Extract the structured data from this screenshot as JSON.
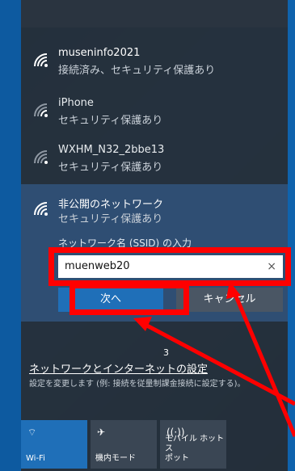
{
  "networks": [
    {
      "name": "museninfo2021",
      "status": "接続済み、セキュリティ保護あり"
    },
    {
      "name": "iPhone",
      "status": "セキュリティ保護あり"
    },
    {
      "name": "WXHM_N32_2bbe13",
      "status": "セキュリティ保護あり"
    },
    {
      "name": "非公開のネットワーク",
      "status": "セキュリティ保護あり"
    }
  ],
  "ssid_form": {
    "label": "ネットワーク名 (SSID) の入力",
    "value": "muenweb20",
    "clear_glyph": "×",
    "next_label": "次へ",
    "cancel_label": "キャンセル"
  },
  "annotation": {
    "step": "3"
  },
  "settings": {
    "link": "ネットワークとインターネットの設定",
    "description": "設定を変更します (例: 接続を従量制課金接続に設定する)。"
  },
  "quick_tiles": [
    {
      "label": "Wi-Fi",
      "icon": "wifi-icon",
      "glyph": "⌔"
    },
    {
      "label": "機内モード",
      "icon": "airplane-icon",
      "glyph": "✈"
    },
    {
      "label": "モバイル ホットス\nポット",
      "icon": "hotspot-icon",
      "glyph": "((·))"
    }
  ],
  "colors": {
    "accent": "#1f6fb8",
    "highlight": "#ff0000",
    "panel": "#262e38",
    "selected": "#2f4e73"
  }
}
